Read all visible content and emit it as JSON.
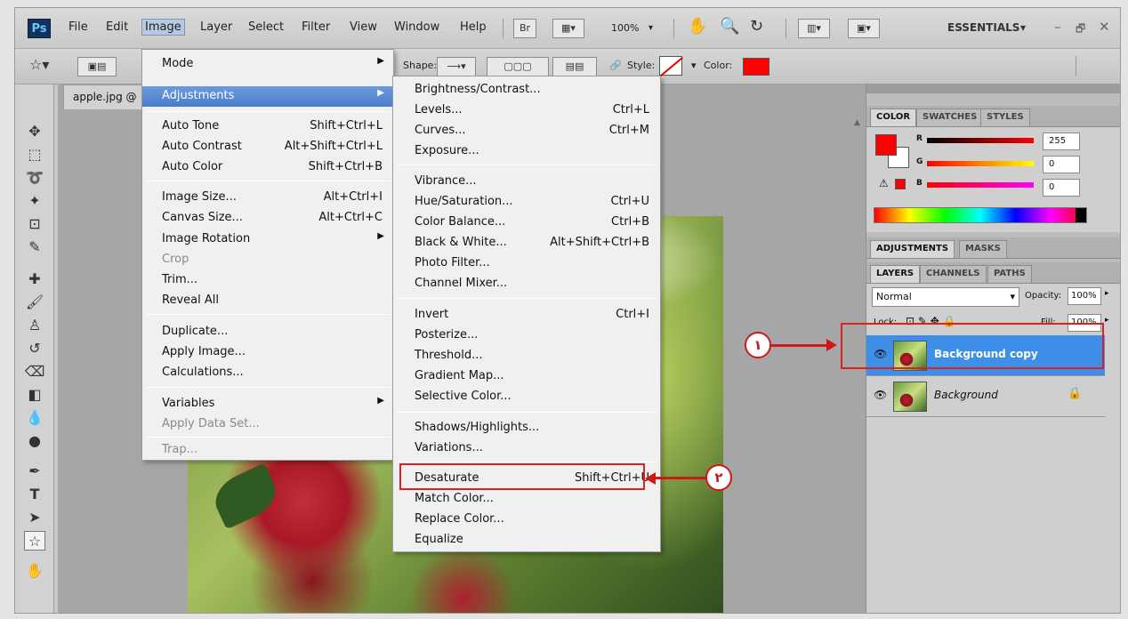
{
  "menubar": {
    "logo": "Ps",
    "items": [
      "File",
      "Edit",
      "Image",
      "Layer",
      "Select",
      "Filter",
      "View",
      "Window",
      "Help"
    ],
    "bridge_label": "Br",
    "zoom": "100%",
    "workspace": "ESSENTIALS",
    "window_controls": [
      "–",
      "🗗",
      "✕"
    ]
  },
  "options": {
    "shape_label": "Shape:",
    "style_label": "Style:",
    "color_label": "Color:",
    "color_value": "#ff0000"
  },
  "document": {
    "tab_title": "apple.jpg @"
  },
  "image_menu": {
    "items": [
      {
        "label": "Mode",
        "shortcut": "",
        "submenu": true
      },
      {
        "label": "Adjustments",
        "shortcut": "",
        "submenu": true,
        "highlighted": true
      },
      {
        "label": "Auto Tone",
        "shortcut": "Shift+Ctrl+L"
      },
      {
        "label": "Auto Contrast",
        "shortcut": "Alt+Shift+Ctrl+L"
      },
      {
        "label": "Auto Color",
        "shortcut": "Shift+Ctrl+B"
      },
      {
        "label": "Image Size...",
        "shortcut": "Alt+Ctrl+I"
      },
      {
        "label": "Canvas Size...",
        "shortcut": "Alt+Ctrl+C"
      },
      {
        "label": "Image Rotation",
        "shortcut": "",
        "submenu": true
      },
      {
        "label": "Crop",
        "shortcut": "",
        "disabled": true
      },
      {
        "label": "Trim...",
        "shortcut": ""
      },
      {
        "label": "Reveal All",
        "shortcut": ""
      },
      {
        "label": "Duplicate...",
        "shortcut": ""
      },
      {
        "label": "Apply Image...",
        "shortcut": ""
      },
      {
        "label": "Calculations...",
        "shortcut": ""
      },
      {
        "label": "Variables",
        "shortcut": "",
        "submenu": true
      },
      {
        "label": "Apply Data Set...",
        "shortcut": "",
        "disabled": true
      },
      {
        "label": "Trap...",
        "shortcut": "",
        "disabled": true
      }
    ]
  },
  "adjustments_menu": {
    "items": [
      {
        "label": "Brightness/Contrast...",
        "shortcut": ""
      },
      {
        "label": "Levels...",
        "shortcut": "Ctrl+L"
      },
      {
        "label": "Curves...",
        "shortcut": "Ctrl+M"
      },
      {
        "label": "Exposure...",
        "shortcut": ""
      },
      {
        "label": "Vibrance...",
        "shortcut": ""
      },
      {
        "label": "Hue/Saturation...",
        "shortcut": "Ctrl+U"
      },
      {
        "label": "Color Balance...",
        "shortcut": "Ctrl+B"
      },
      {
        "label": "Black & White...",
        "shortcut": "Alt+Shift+Ctrl+B"
      },
      {
        "label": "Photo Filter...",
        "shortcut": ""
      },
      {
        "label": "Channel Mixer...",
        "shortcut": ""
      },
      {
        "label": "Invert",
        "shortcut": "Ctrl+I"
      },
      {
        "label": "Posterize...",
        "shortcut": ""
      },
      {
        "label": "Threshold...",
        "shortcut": ""
      },
      {
        "label": "Gradient Map...",
        "shortcut": ""
      },
      {
        "label": "Selective Color...",
        "shortcut": ""
      },
      {
        "label": "Shadows/Highlights...",
        "shortcut": ""
      },
      {
        "label": "Variations...",
        "shortcut": ""
      },
      {
        "label": "Desaturate",
        "shortcut": "Shift+Ctrl+U"
      },
      {
        "label": "Match Color...",
        "shortcut": ""
      },
      {
        "label": "Replace Color...",
        "shortcut": ""
      },
      {
        "label": "Equalize",
        "shortcut": ""
      }
    ]
  },
  "color_panel": {
    "tabs": [
      "COLOR",
      "SWATCHES",
      "STYLES"
    ],
    "channels": [
      {
        "name": "R",
        "value": "255"
      },
      {
        "name": "G",
        "value": "0"
      },
      {
        "name": "B",
        "value": "0"
      }
    ],
    "foreground": "#ff0000"
  },
  "adjust_panel": {
    "tabs": [
      "ADJUSTMENTS",
      "MASKS"
    ]
  },
  "layers_panel": {
    "tabs": [
      "LAYERS",
      "CHANNELS",
      "PATHS"
    ],
    "blend_mode": "Normal",
    "opacity_label": "Opacity:",
    "opacity": "100%",
    "lock_label": "Lock:",
    "fill_label": "Fill:",
    "fill": "100%",
    "layers": [
      {
        "name": "Background copy",
        "selected": true
      },
      {
        "name": "Background",
        "selected": false
      }
    ]
  },
  "annotations": {
    "step1": "١",
    "step2": "٢"
  }
}
